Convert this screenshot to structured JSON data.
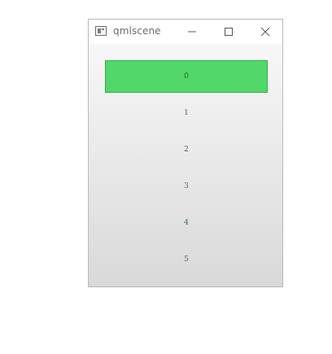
{
  "window": {
    "title": "qmlscene",
    "icon": "qt-app-icon",
    "controls": [
      "minimize-icon",
      "maximize-icon",
      "close-icon"
    ]
  },
  "list": {
    "selected_index": 0,
    "selected_color": "#52d76a",
    "items": [
      {
        "label": "0"
      },
      {
        "label": "1"
      },
      {
        "label": "2"
      },
      {
        "label": "3"
      },
      {
        "label": "4"
      },
      {
        "label": "5"
      }
    ]
  }
}
